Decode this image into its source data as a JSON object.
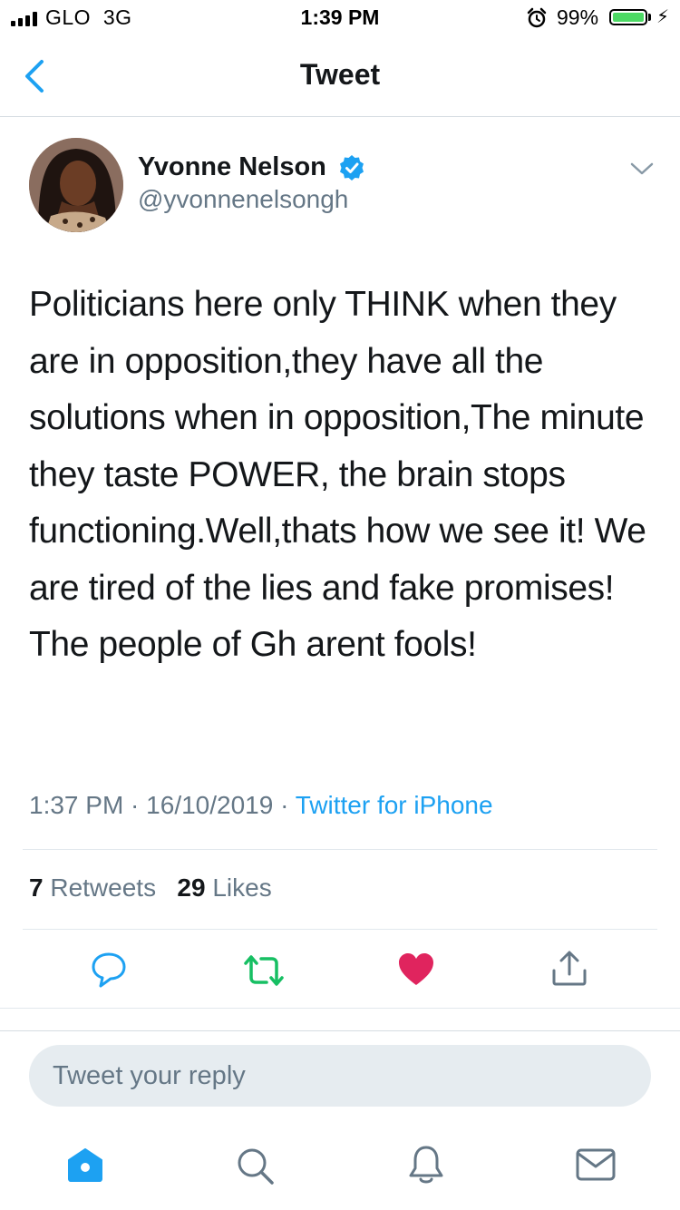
{
  "status_bar": {
    "carrier": "GLO  3G",
    "time": "1:39 PM",
    "battery_percent": "99%",
    "battery_level": 0.99,
    "battery_color": "#4cd964",
    "icons": [
      "signal-icon",
      "alarm-icon",
      "battery-icon",
      "charging-bolt-icon"
    ]
  },
  "nav": {
    "title": "Tweet",
    "back_icon": "chevron-left-icon"
  },
  "tweet": {
    "author_name": "Yvonne Nelson",
    "handle": "@yvonnenelsongh",
    "verified": true,
    "text": "Politicians here only THINK when they are in opposition,they have all the solutions when in opposition,The minute they taste POWER, the brain stops functioning.Well,thats how we see it! We are tired of the lies and fake promises! The people of Gh arent fools!",
    "time": "1:37 PM",
    "date": "16/10/2019",
    "source": "Twitter for iPhone",
    "retweets_count": "7",
    "retweets_label": "Retweets",
    "likes_count": "29",
    "likes_label": "Likes"
  },
  "actions": [
    {
      "name": "reply-icon",
      "color": "#1da1f2"
    },
    {
      "name": "retweet-icon",
      "color": "#17bf63"
    },
    {
      "name": "like-icon",
      "color": "#e0245e"
    },
    {
      "name": "share-icon",
      "color": "#1da1f2"
    }
  ],
  "reply": {
    "placeholder": "Tweet your reply"
  },
  "tab_bar": [
    {
      "name": "home-icon",
      "active": true
    },
    {
      "name": "search-icon",
      "active": false
    },
    {
      "name": "notifications-icon",
      "active": false
    },
    {
      "name": "messages-icon",
      "active": false
    }
  ],
  "colors": {
    "accent": "#1da1f2",
    "text": "#14171a",
    "secondary_text": "#657786",
    "divider": "#e1e8ed"
  }
}
